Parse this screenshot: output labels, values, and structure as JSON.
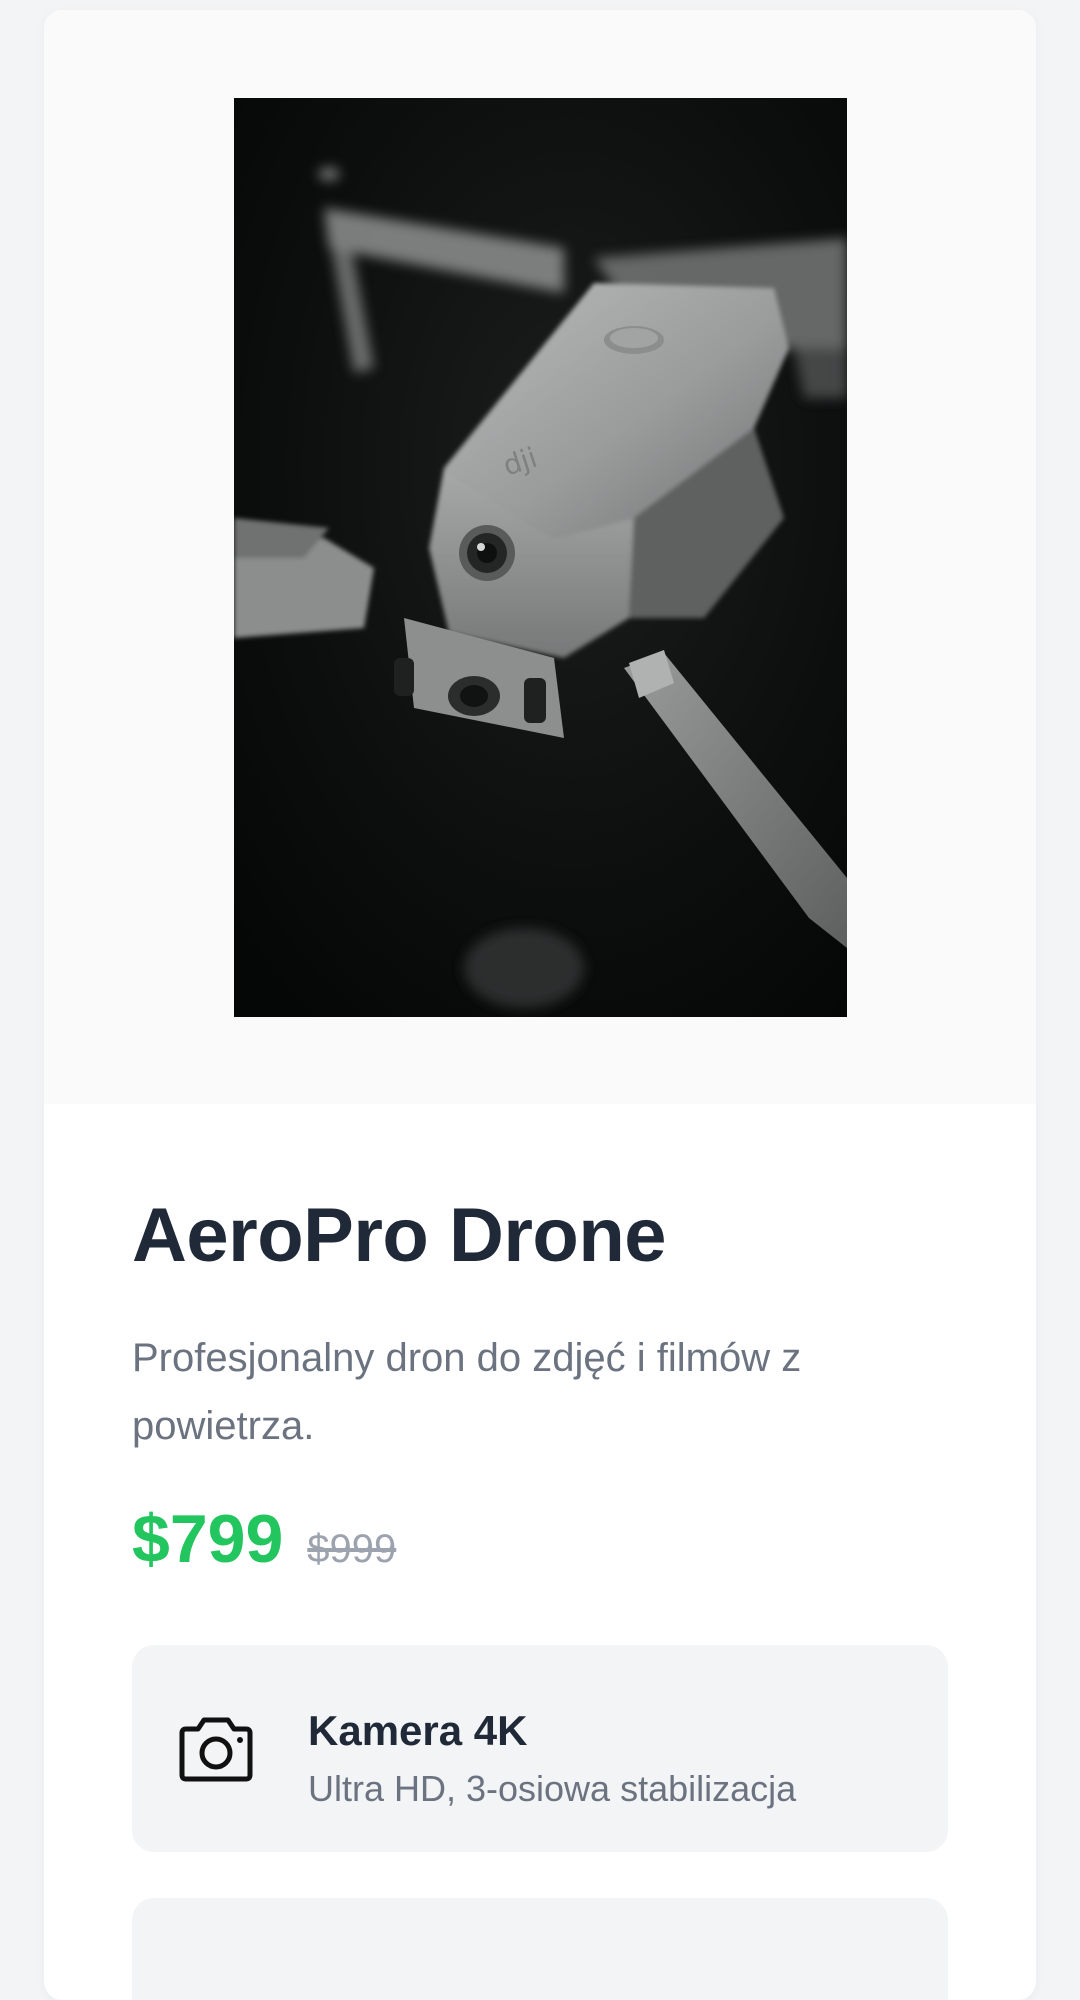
{
  "product": {
    "title": "AeroPro Drone",
    "description": "Profesjonalny dron do zdjęć i filmów z powietrza.",
    "price_current": "$799",
    "price_old": "$999",
    "image": {
      "subject": "Grey folding quadcopter drone with arms extended, dark background",
      "logo_text": "dji"
    }
  },
  "features": [
    {
      "icon": "camera-icon",
      "title": "Kamera 4K",
      "subtitle": "Ultra HD, 3-osiowa stabilizacja"
    }
  ],
  "colors": {
    "page_bg": "#f3f4f6",
    "card_bg": "#ffffff",
    "image_area_bg": "#fafafa",
    "title": "#1f2937",
    "muted_text": "#6b7280",
    "price_accent": "#22c55e",
    "old_price": "#9ca3af",
    "feature_bg": "#f3f4f6"
  }
}
